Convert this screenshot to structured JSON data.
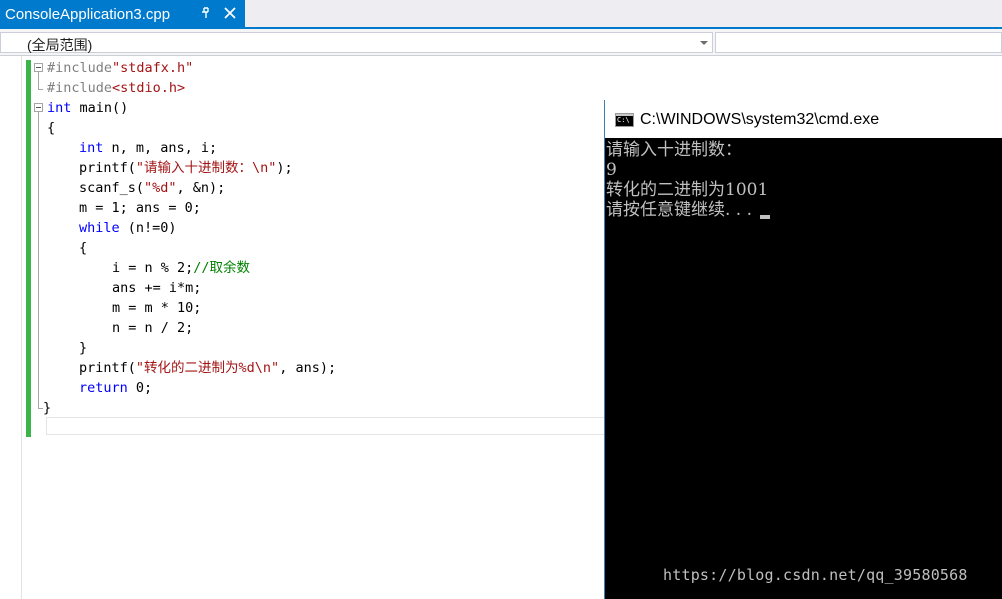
{
  "tabs": [
    {
      "label": "ConsoleApplication3.cpp",
      "active": true
    }
  ],
  "tab_icons": {
    "pin": "pin-icon",
    "close": "close-icon"
  },
  "scope_bar": {
    "scope_label": "(全局范围)",
    "member_label": ""
  },
  "code": {
    "line1_directive": "#include",
    "line1_header": "\"stdafx.h\"",
    "line2_directive": "#include",
    "line2_header": "<stdio.h>",
    "line3_kw": "int",
    "line3_rest": " main()",
    "line4": "{",
    "line5_kw": "int",
    "line5_rest": " n, m, ans, i;",
    "line6_pre": "printf(",
    "line6_str": "\"请输入十进制数：\\n\"",
    "line6_post": ");",
    "line7_pre": "scanf_s(",
    "line7_str": "\"%d\"",
    "line7_post": ", &n);",
    "line8": "m = 1; ans = 0;",
    "line9_kw": "while",
    "line9_rest": " (n!=0)",
    "line10": "{",
    "line11_code": "i = n % 2;",
    "line11_comment": "//取余数",
    "line12": "ans += i*m;",
    "line13": "m = m * 10;",
    "line14": "n = n / 2;",
    "line15": "}",
    "line16_pre": "printf(",
    "line16_str": "\"转化的二进制为%d\\n\"",
    "line16_post": ", ans);",
    "line17_kw": "return",
    "line17_rest": " 0;",
    "line18": "}"
  },
  "console": {
    "title": "C:\\WINDOWS\\system32\\cmd.exe",
    "lines": [
      "请输入十进制数：",
      "9",
      "转化的二进制为1001",
      "请按任意键继续. . ."
    ],
    "watermark": "https://blog.csdn.net/qq_39580568"
  },
  "colors": {
    "accent": "#007acc",
    "keyword": "#0000ff",
    "string": "#a31515",
    "comment": "#008000",
    "preprocessor": "#808080",
    "change_bar": "#3bb44a",
    "console_bg": "#000000",
    "console_text": "#c0c0c0"
  }
}
